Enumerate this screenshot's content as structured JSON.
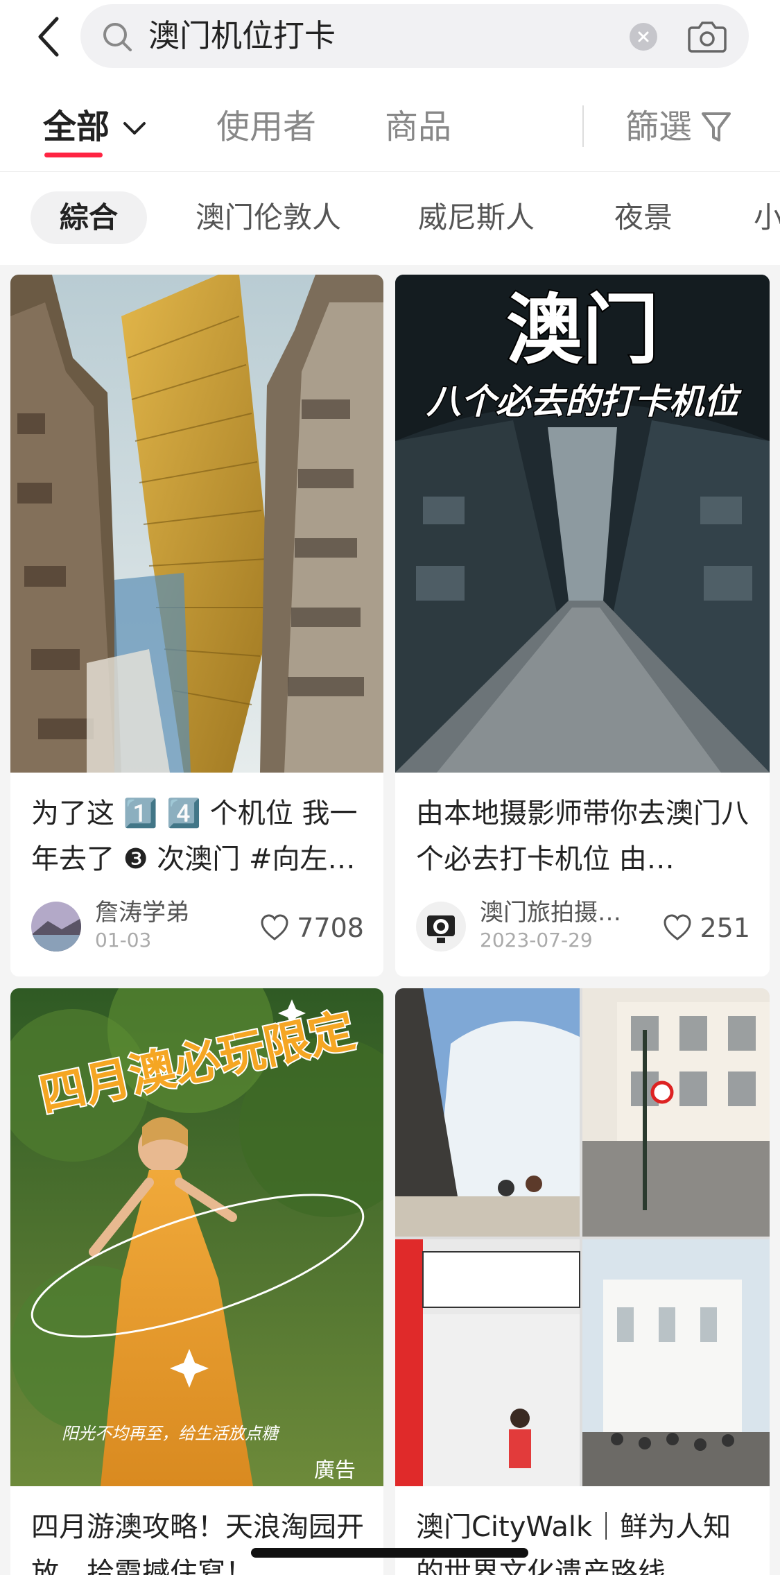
{
  "search": {
    "query": "澳门机位打卡"
  },
  "tabs": {
    "all": "全部",
    "users": "使用者",
    "goods": "商品",
    "filter": "篩選"
  },
  "chips": [
    "綜合",
    "澳门伦敦人",
    "威尼斯人",
    "夜景",
    "小"
  ],
  "cards": [
    {
      "title": "为了这 1️⃣ 4️⃣ 个机位 我一年去了 ❸ 次澳门 #向左…",
      "author": "詹涛学弟",
      "date": "01-03",
      "likes": "7708"
    },
    {
      "title": "由本地摄影师带你去澳门八个必去打卡机位 由…",
      "author": "澳门旅拍摄…",
      "date": "2023-07-29",
      "likes": "251",
      "image_text": {
        "headline": "澳门",
        "subline": "八个必去的打卡机位"
      }
    },
    {
      "title": "四月游澳攻略！天浪淘园开放，拾霞撼住寫！",
      "ad_label": "廣告",
      "image_text": {
        "headline": "四月澳必玩限定",
        "caption": "阳光不均再至，给生活放点糖"
      }
    },
    {
      "title": "澳门CityWalk｜鲜为人知的世界文化遗产路线"
    }
  ],
  "colors": {
    "accent": "#ff2442",
    "background": "#f4f4f4"
  }
}
